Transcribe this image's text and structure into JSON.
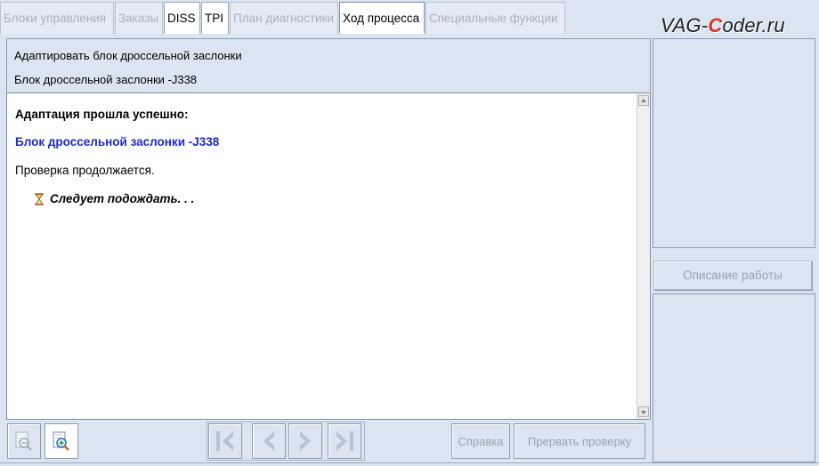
{
  "tabs": [
    {
      "label": "Блоки управления",
      "state": "disabled"
    },
    {
      "label": "Заказы",
      "state": "disabled"
    },
    {
      "label": "DISS",
      "state": "enabled"
    },
    {
      "label": "TPI",
      "state": "enabled"
    },
    {
      "label": "План диагностики",
      "state": "disabled"
    },
    {
      "label": "Ход процесса",
      "state": "active"
    },
    {
      "label": "Специальные функции",
      "state": "disabled"
    }
  ],
  "logo": {
    "prefix": "VAG-",
    "highlight": "C",
    "suffix": "oder.ru"
  },
  "header": {
    "line1": "Адаптировать блок дроссельной заслонки",
    "line2": "Блок дроссельной заслонки -J338"
  },
  "content": {
    "title": "Адаптация прошла успешно:",
    "unit": "Блок дроссельной заслонки -J338",
    "status": "Проверка продолжается.",
    "wait": "Следует подождать. . ."
  },
  "toolbar": {
    "zoom_out_icon": "zoom-out-icon",
    "zoom_in_icon": "zoom-in-icon",
    "nav_icons": [
      "first-icon",
      "prev-icon",
      "next-icon",
      "last-icon"
    ],
    "help_label": "Справка",
    "abort_label": "Прервать проверку"
  },
  "right_panel": {
    "description_button": "Описание работы"
  },
  "colors": {
    "background": "#dbe5f1",
    "unit_text": "#1d2bbf",
    "disabled_text": "#9aa4b0",
    "logo_accent": "#e03020"
  }
}
